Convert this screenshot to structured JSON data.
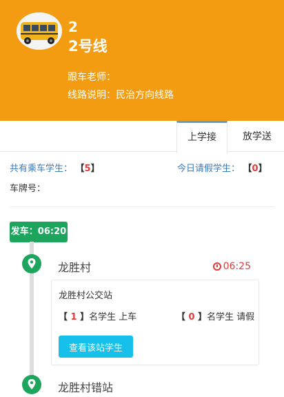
{
  "header": {
    "route_number": "2",
    "route_name": "2号线",
    "teacher_label": "跟车老师：",
    "teacher_value": "",
    "route_desc_label": "线路说明：",
    "route_desc_value": "民治方向线路",
    "bg_color": "#f39c12"
  },
  "tabs": [
    {
      "label": "上学接",
      "active": true
    },
    {
      "label": "放学送",
      "active": false
    }
  ],
  "stats": {
    "total_label": "共有乘车学生：",
    "total_value": "5",
    "leave_label": "今日请假学生：",
    "leave_value": "0",
    "plate_label": "车牌号：",
    "plate_value": ""
  },
  "departure": {
    "label": "发车：06:20"
  },
  "stops": [
    {
      "name": "龙胜村",
      "time": "06:25",
      "station": "龙胜村公交站",
      "board_count": "1",
      "board_suffix": "名学生 上车",
      "leave_count": "0",
      "leave_suffix": "名学生 请假",
      "button_label": "查看该站学生"
    },
    {
      "name": "龙胜村错站"
    }
  ],
  "colors": {
    "accent_orange": "#f39c12",
    "green": "#1da55e",
    "red": "#e23b3b",
    "button_cyan": "#16c0ea"
  }
}
